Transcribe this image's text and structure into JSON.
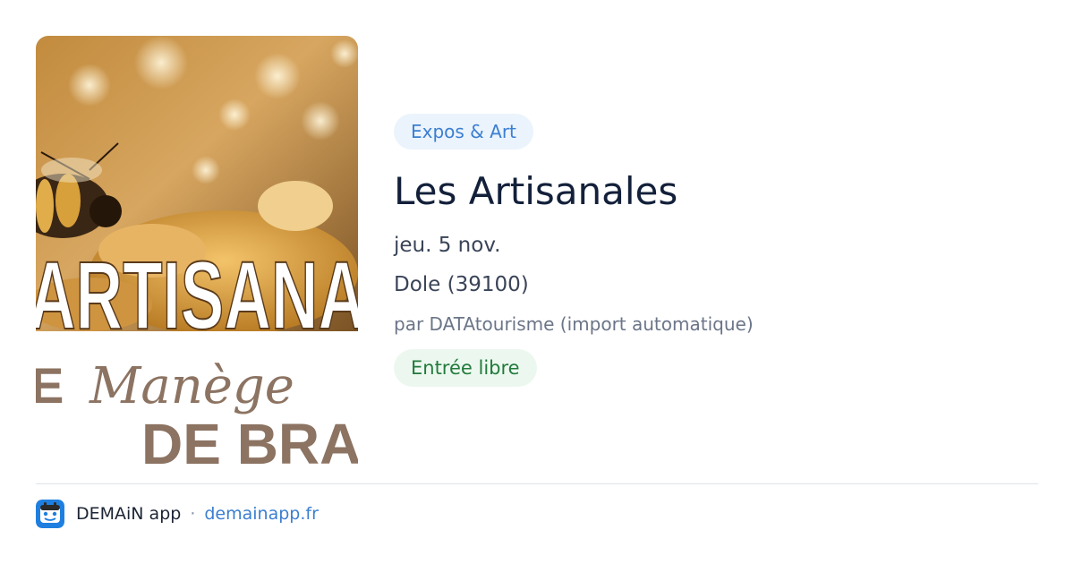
{
  "event": {
    "category": "Expos & Art",
    "title": "Les Artisanales",
    "date": "jeu. 5 nov.",
    "location": "Dole (39100)",
    "source": "par DATAtourisme (import automatique)",
    "price": "Entrée libre"
  },
  "poster": {
    "headline": "ARTISANA",
    "script_line": "Manège",
    "bottom_line": "DE BRA",
    "left_fragment": "E"
  },
  "footer": {
    "app_name": "DEMAiN app",
    "separator": "·",
    "domain": "demainapp.fr"
  },
  "colors": {
    "category_bg": "#ebf3fc",
    "category_text": "#3b7fd1",
    "price_bg": "#ecf8ef",
    "price_text": "#237a3c",
    "title_text": "#13203a",
    "poster_brown": "#8c7362",
    "logo_blue": "#1f7fe0"
  },
  "icons": {
    "app_logo": "demain-app-logo-icon",
    "poster": "event-poster-image"
  }
}
